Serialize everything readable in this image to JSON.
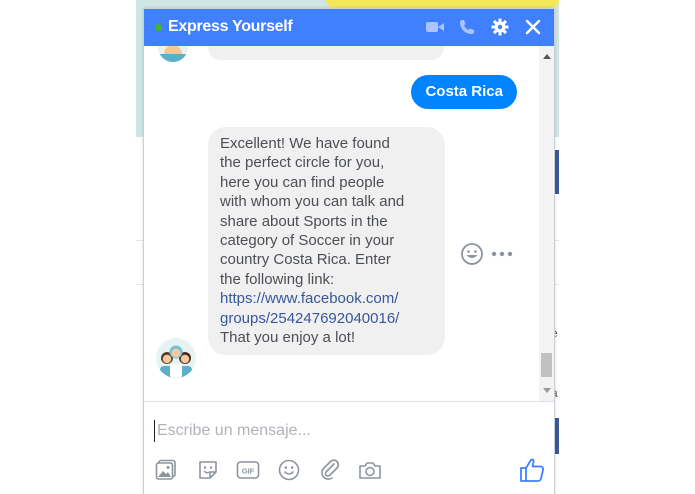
{
  "chat": {
    "title": "Express Yourself",
    "status": "online",
    "header_icons": [
      "video-camera-icon",
      "phone-icon",
      "gear-icon",
      "close-icon"
    ]
  },
  "messages": {
    "outgoing": "Costa Rica",
    "incoming_lines": [
      "Excellent! We have found",
      "the perfect circle for you,",
      "here you can find people",
      "with whom you can talk and",
      "share about Sports in the",
      "category of Soccer in your",
      "country Costa Rica. Enter",
      "the following link:"
    ],
    "link_lines": [
      "https://www.facebook.com/",
      "groups/254247692040016/"
    ],
    "closing_line": "That you enjoy a lot!"
  },
  "composer": {
    "placeholder": "Escribe un mensaje...",
    "tools": [
      "image-icon",
      "sticker-icon",
      "gif-icon",
      "emoji-icon",
      "attachment-icon",
      "camera-icon"
    ],
    "send": "like-icon"
  },
  "background_page": {
    "side_letters": [
      "e",
      "a"
    ]
  },
  "colors": {
    "header": "#4080ff",
    "outgoing_bubble": "#0084ff",
    "incoming_bubble": "#f1f0f0",
    "link": "#365899",
    "online": "#42b72a"
  }
}
